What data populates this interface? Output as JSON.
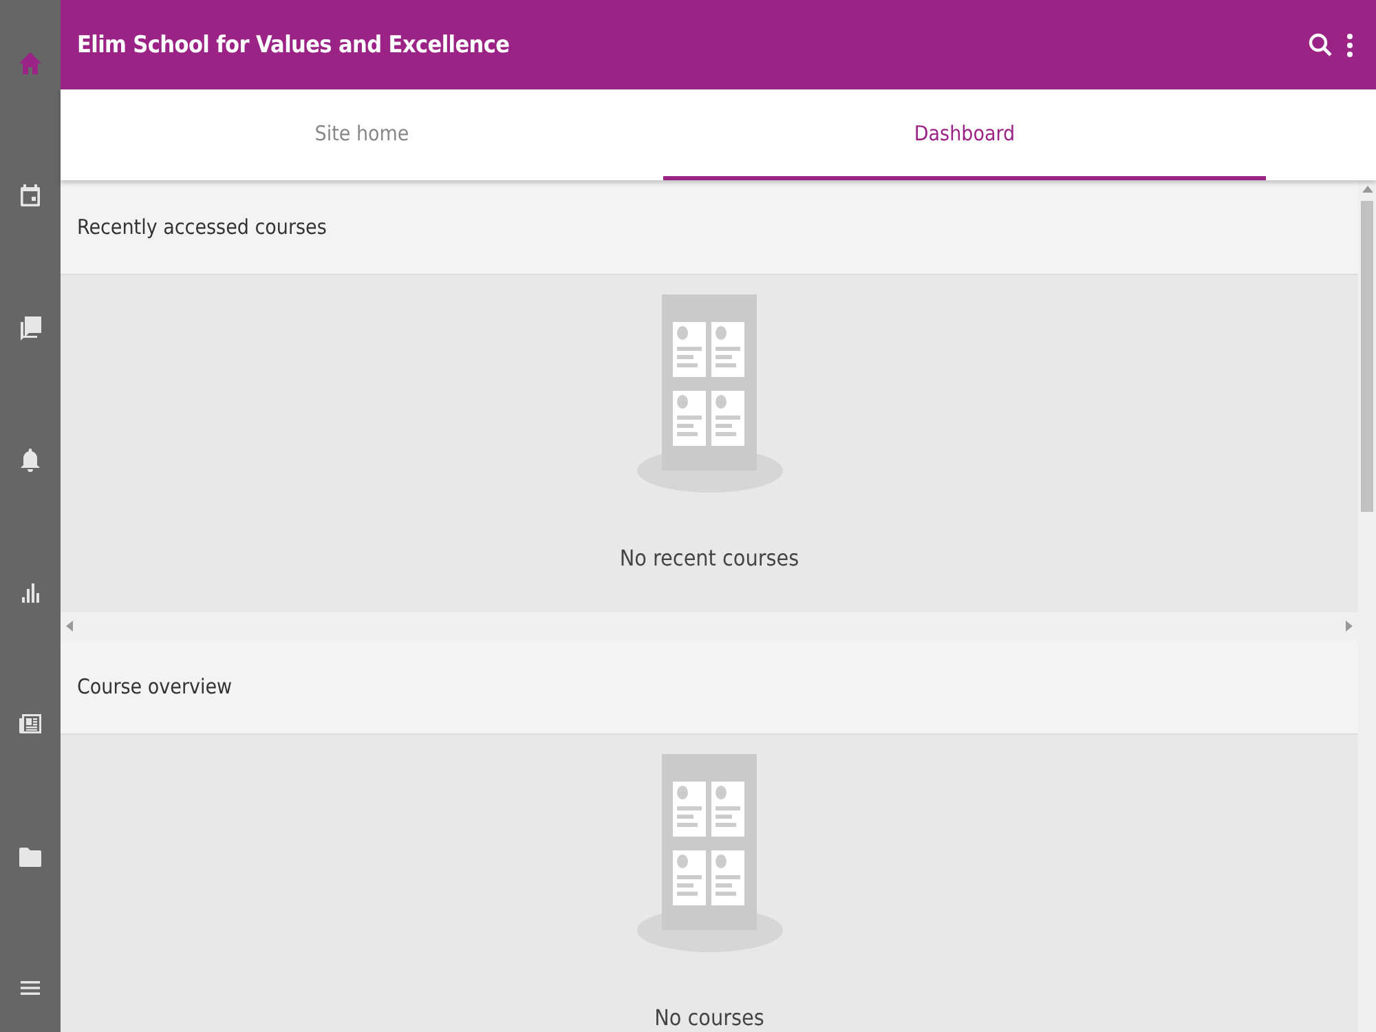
{
  "sidebar": {
    "items": [
      {
        "kind": "home",
        "selected": true
      },
      {
        "kind": "calendar",
        "selected": false
      },
      {
        "kind": "messages",
        "selected": false
      },
      {
        "kind": "bell",
        "selected": false
      },
      {
        "kind": "chart",
        "selected": false
      },
      {
        "kind": "news",
        "selected": false
      },
      {
        "kind": "folder",
        "selected": false
      },
      {
        "kind": "menu",
        "selected": false
      }
    ]
  },
  "header": {
    "title": "Elim School for Values and Excellence"
  },
  "tabs": [
    {
      "label": "Site home",
      "selected": false
    },
    {
      "label": "Dashboard",
      "selected": true
    }
  ],
  "sections": [
    {
      "title": "Recently accessed courses",
      "empty_message": "No recent courses",
      "horizontal_scroll": true
    },
    {
      "title": "Course overview",
      "empty_message": "No courses",
      "horizontal_scroll": false
    }
  ]
}
